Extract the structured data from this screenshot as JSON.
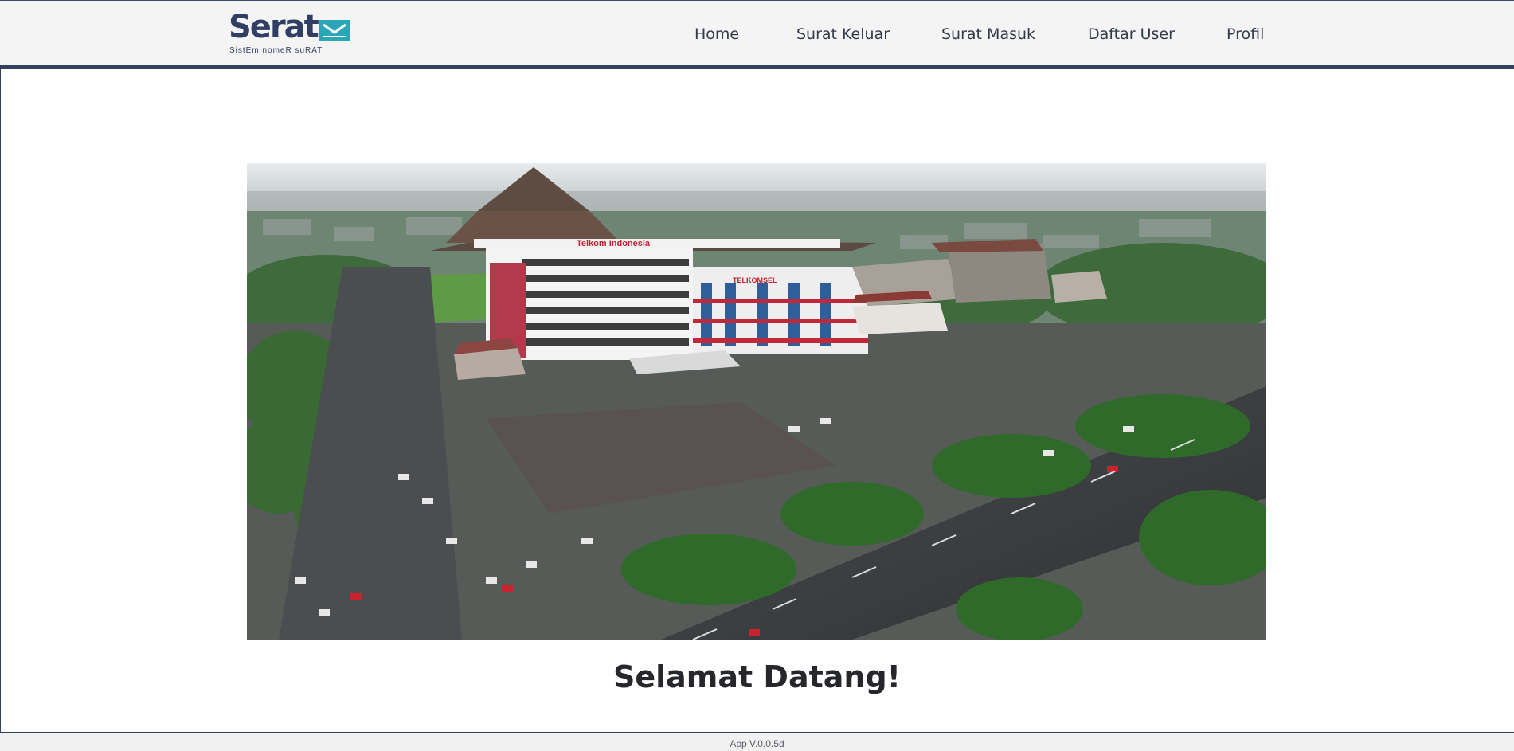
{
  "brand": {
    "name": "Serat",
    "tagline": "SistEm nomeR suRAT",
    "colors": {
      "primary": "#2f3e62",
      "accent": "#2aa6b7"
    }
  },
  "nav": {
    "items": [
      {
        "label": "Home"
      },
      {
        "label": "Surat Keluar"
      },
      {
        "label": "Surat Masuk"
      },
      {
        "label": "Daftar User"
      },
      {
        "label": "Profil"
      }
    ]
  },
  "hero": {
    "building_sign_main": "Telkom Indonesia",
    "building_sign_annex": "TELKOMSEL"
  },
  "main": {
    "welcome": "Selamat Datang!"
  },
  "footer": {
    "version": "App V.0.0.5d"
  }
}
